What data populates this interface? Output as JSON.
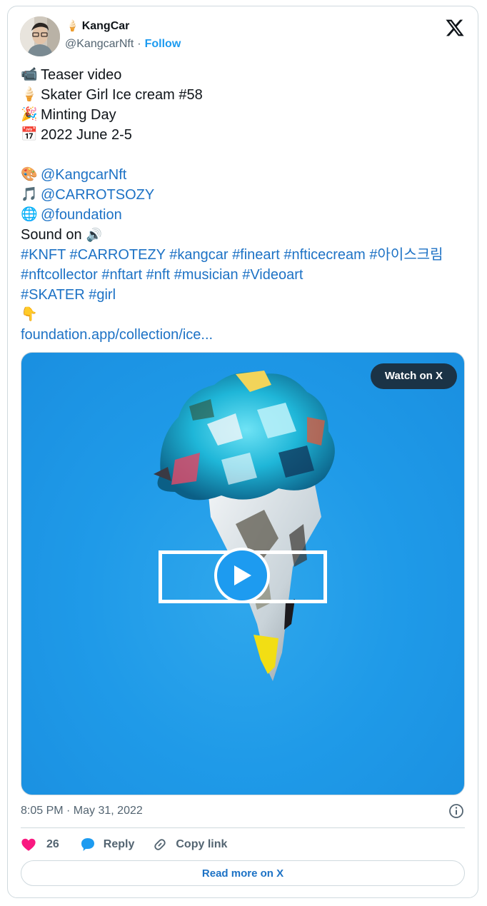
{
  "author": {
    "name_emoji": "🍦",
    "display_name": "KangCar",
    "handle": "@KangcarNft",
    "separator": "·",
    "follow_label": "Follow"
  },
  "tweet": {
    "lines": [
      {
        "emoji": "📹",
        "text": "Teaser video"
      },
      {
        "emoji": "🍦",
        "text": "Skater Girl Ice cream #58"
      },
      {
        "emoji": "🎉",
        "text": "Minting Day"
      },
      {
        "emoji": "📅",
        "text": "2022 June 2-5"
      }
    ],
    "mentions": [
      {
        "emoji": "🎨",
        "text": "@KangcarNft"
      },
      {
        "emoji": "🎵",
        "text": "@CARROTSOZY"
      },
      {
        "emoji": "🌐",
        "text": "@foundation"
      }
    ],
    "sound_text": "Sound on",
    "sound_emoji": "🔊",
    "hashtags": [
      "#KNFT",
      "#CARROTEZY",
      "#kangcar",
      "#fineart",
      "#nfticecream",
      "#아이스크림",
      "#nftcollector",
      "#nftart",
      "#nft",
      "#musician",
      "#Videoart",
      "#SKATER",
      "#girl"
    ],
    "point_emoji": "👇",
    "link_text": "foundation.app/collection/ice..."
  },
  "media": {
    "watch_label": "Watch on X",
    "background_color": "#1f9ae8"
  },
  "meta": {
    "timestamp": "8:05 PM · May 31, 2022"
  },
  "actions": {
    "like_count": "26",
    "reply_label": "Reply",
    "copy_label": "Copy link",
    "read_more_label": "Read more on X"
  },
  "colors": {
    "link": "#1d72c5",
    "accent": "#1d9bf0",
    "like": "#f91880",
    "secondary_text": "#536471"
  }
}
